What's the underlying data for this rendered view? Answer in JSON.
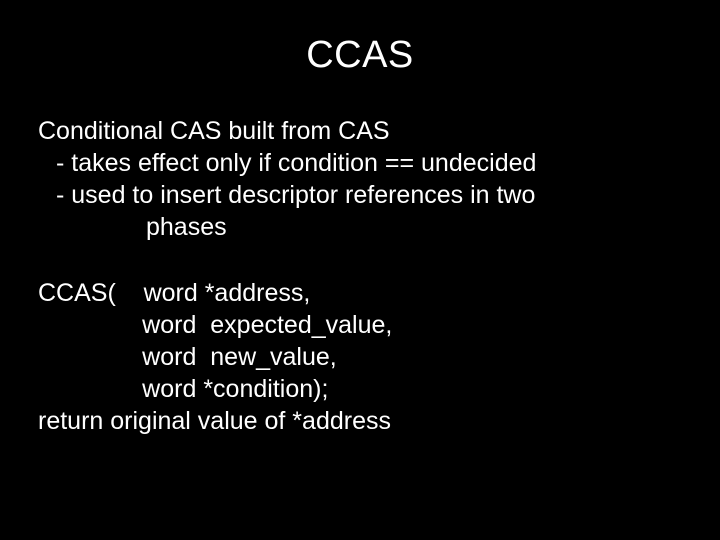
{
  "title": "CCAS",
  "p1": {
    "l1": "Conditional CAS built from CAS",
    "l2": "- takes effect only if condition == undecided",
    "l3": "- used to insert descriptor references in two",
    "l4": "phases"
  },
  "sig": {
    "l1": "CCAS(    word *address,",
    "l2": "               word  expected_value,",
    "l3": "               word  new_value,",
    "l4": "               word *condition);",
    "l5": "return original value of *address"
  }
}
